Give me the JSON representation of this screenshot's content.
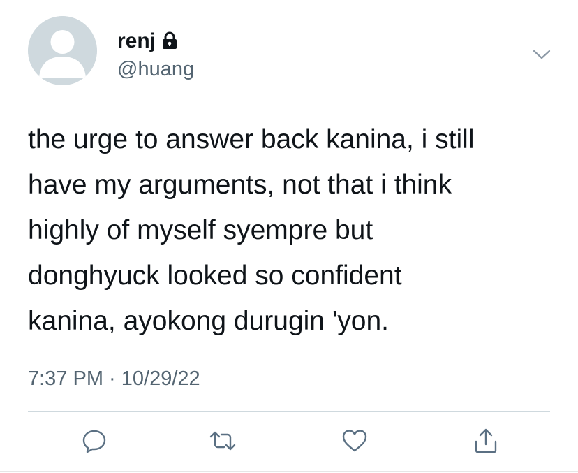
{
  "user": {
    "display_name": "renj",
    "handle": "@huang",
    "protected_icon": "lock-icon",
    "avatar": "default-avatar"
  },
  "tweet": {
    "text": "the urge to answer back kanina, i still\nhave my arguments, not that i think\nhighly of myself syempre but\ndonghyuck looked so confident\nkanina, ayokong durugin 'yon.",
    "timestamp": "7:37 PM · 10/29/22"
  },
  "menu_icon": "chevron-down-icon",
  "actions": [
    {
      "icon": "reply-icon"
    },
    {
      "icon": "retweet-icon"
    },
    {
      "icon": "like-icon"
    },
    {
      "icon": "share-icon"
    }
  ],
  "colors": {
    "text": "#0f1419",
    "secondary": "#536471",
    "icon": "#5b7083",
    "avatar_bg": "#cfd9de",
    "divider": "#cfd9de"
  }
}
